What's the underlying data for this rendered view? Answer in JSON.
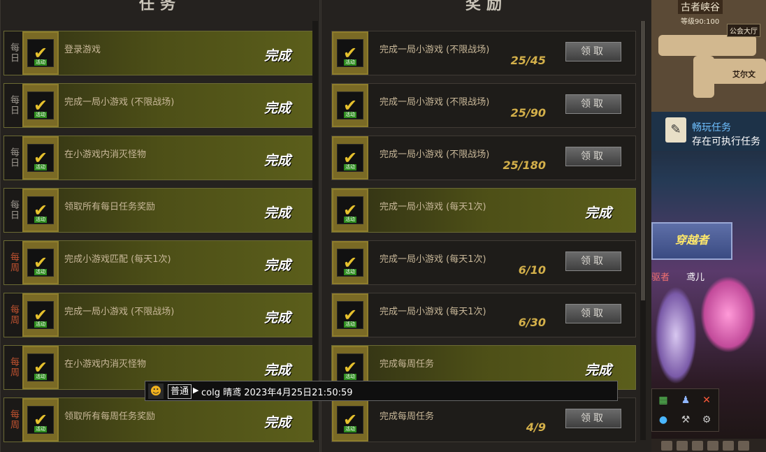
{
  "panels": {
    "left_header": "任务",
    "right_header": "奖励"
  },
  "left_rows": [
    {
      "freq": "每日",
      "title": "登录游戏",
      "status": "完成"
    },
    {
      "freq": "每日",
      "title": "完成一局小游戏 (不限战场)",
      "status": "完成"
    },
    {
      "freq": "每日",
      "title": "在小游戏内消灭怪物",
      "status": "完成"
    },
    {
      "freq": "每日",
      "title": "领取所有每日任务奖励",
      "status": "完成"
    },
    {
      "freq": "每周",
      "title": "完成小游戏匹配 (每天1次)",
      "status": "完成"
    },
    {
      "freq": "每周",
      "title": "完成一局小游戏 (不限战场)",
      "status": "完成"
    },
    {
      "freq": "每周",
      "title": "在小游戏内消灭怪物",
      "status": "完成"
    },
    {
      "freq": "每周",
      "title": "领取所有每周任务奖励",
      "status": "完成"
    }
  ],
  "right_rows": [
    {
      "title": "完成一局小游戏 (不限战场)",
      "progress": "25/45",
      "button": "领取",
      "status": ""
    },
    {
      "title": "完成一局小游戏 (不限战场)",
      "progress": "25/90",
      "button": "领取",
      "status": ""
    },
    {
      "title": "完成一局小游戏 (不限战场)",
      "progress": "25/180",
      "button": "领取",
      "status": ""
    },
    {
      "title": "完成一局小游戏 (每天1次)",
      "progress": "",
      "button": "",
      "status": "完成"
    },
    {
      "title": "完成一局小游戏 (每天1次)",
      "progress": "6/10",
      "button": "领取",
      "status": ""
    },
    {
      "title": "完成一局小游戏 (每天1次)",
      "progress": "6/30",
      "button": "领取",
      "status": ""
    },
    {
      "title": "完成每周任务",
      "progress": "",
      "button": "",
      "status": "完成"
    },
    {
      "title": "完成每周任务",
      "progress": "4/9",
      "button": "领取",
      "status": ""
    }
  ],
  "icon_tag": "活动",
  "chat": {
    "channel": "普通",
    "message": "colg 晴鸢 2023年4月25日21:50:59"
  },
  "side": {
    "map_title": "古者峡谷",
    "map_level": "等级90:100",
    "guild_hall": "公会大厅",
    "elven": "艾尔文",
    "notice_title": "畅玩任务",
    "notice_sub": "存在可执行任务",
    "banner": "穿越者",
    "player1": "驱者",
    "player2": "鸢儿"
  },
  "colors": {
    "done_row": "#5b5e1b",
    "progress_text": "#d4b04a",
    "weekly_label": "#c25330"
  }
}
